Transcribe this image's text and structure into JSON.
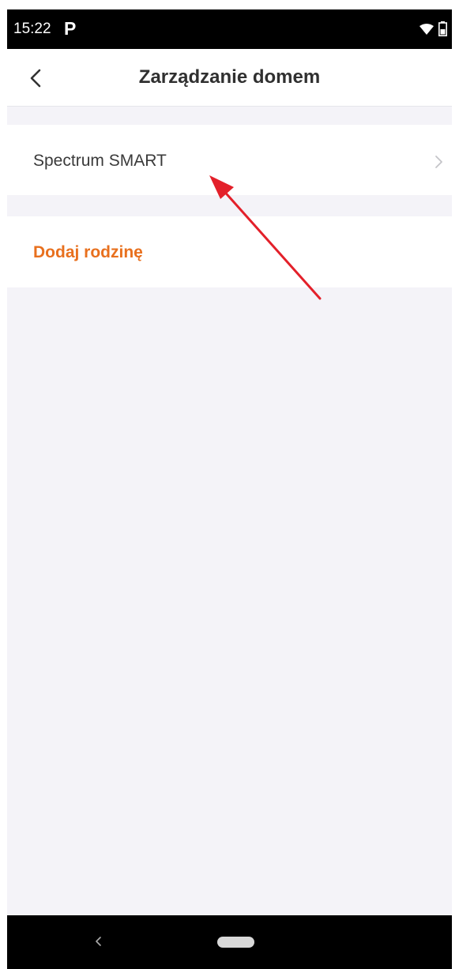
{
  "status_bar": {
    "time": "15:22",
    "notification_icon": "P",
    "wifi_icon": "wifi-icon",
    "battery_icon": "battery-icon"
  },
  "header": {
    "title": "Zarządzanie domem",
    "back_icon": "chevron-left-icon"
  },
  "homes": [
    {
      "label": "Spectrum SMART",
      "icon": "chevron-right-icon"
    }
  ],
  "add_family": {
    "label": "Dodaj rodzinę"
  },
  "colors": {
    "accent": "#e8701e",
    "annotation": "#e3202a",
    "background": "#f4f3f8"
  },
  "nav_bar": {
    "back_icon": "nav-back-icon",
    "home_icon": "nav-home-pill"
  }
}
